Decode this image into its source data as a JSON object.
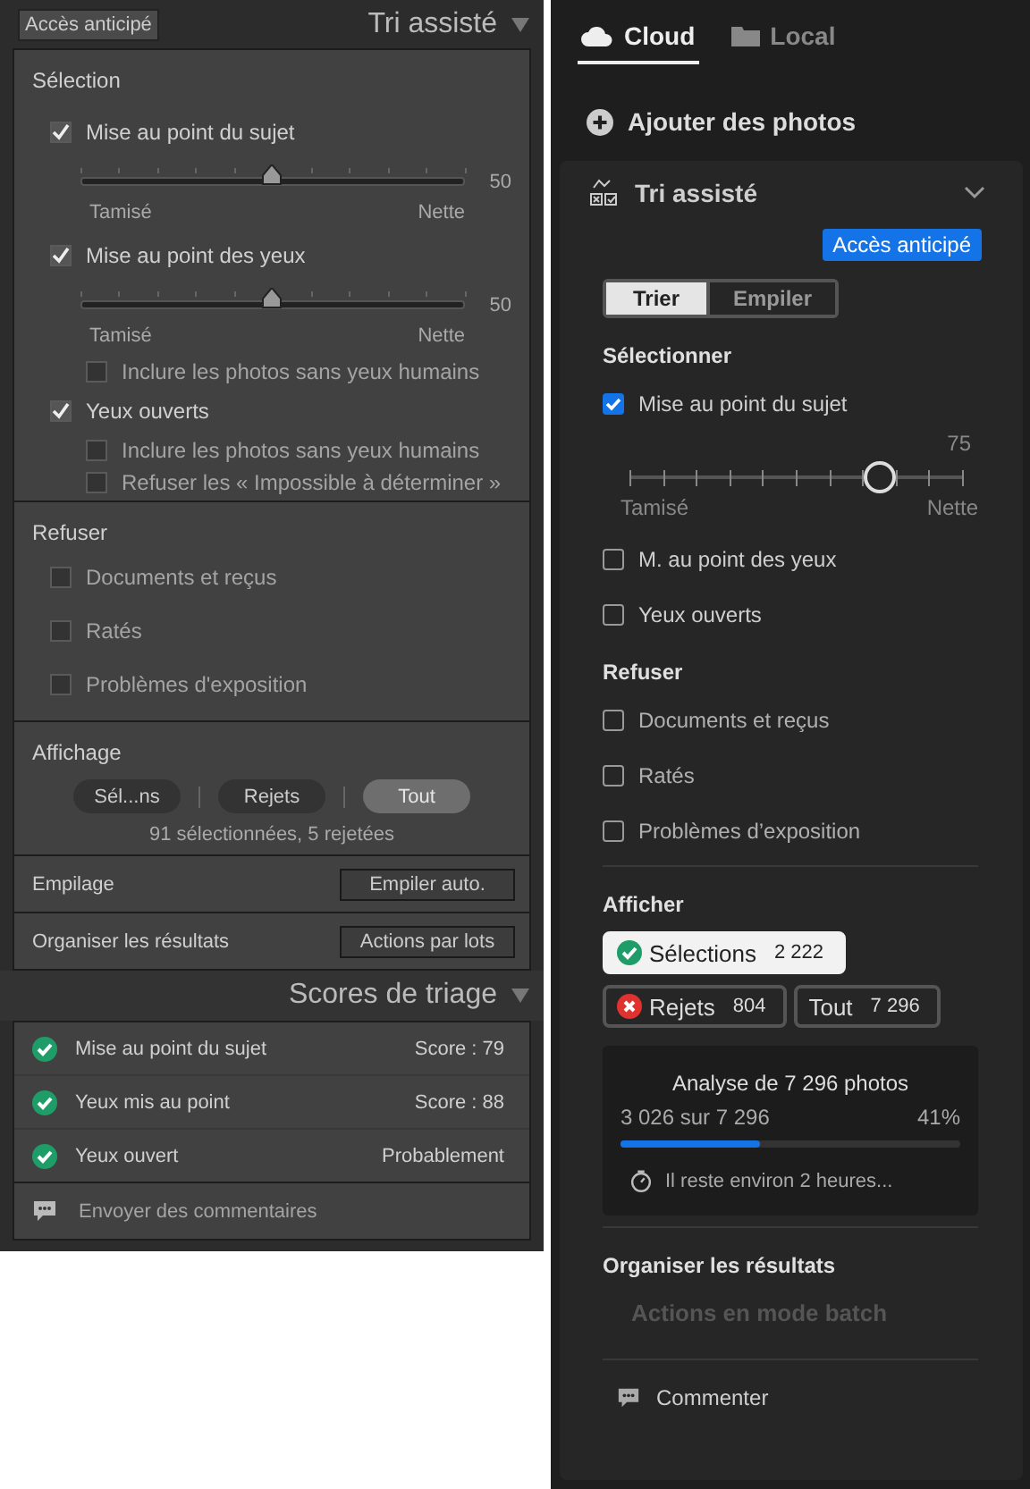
{
  "classic": {
    "early_access": "Accès anticipé",
    "title": "Tri assisté",
    "selection": {
      "heading": "Sélection",
      "criteria": [
        {
          "label": "Mise au point du sujet",
          "checked": true,
          "slider": {
            "level": 0.5,
            "reading": "50",
            "min_label": "Tamisé",
            "max_label": "Nette"
          }
        },
        {
          "label": "Mise au point des yeux",
          "checked": true,
          "slider": {
            "level": 0.5,
            "reading": "50",
            "min_label": "Tamisé",
            "max_label": "Nette"
          },
          "options": [
            {
              "label": "Inclure les photos sans yeux humains",
              "checked": false
            }
          ]
        },
        {
          "label": "Yeux ouverts",
          "checked": true,
          "options": [
            {
              "label": "Inclure les photos sans yeux humains",
              "checked": false
            },
            {
              "label": "Refuser les « Impossible à déterminer »",
              "checked": false
            }
          ]
        }
      ]
    },
    "reject": {
      "heading": "Refuser",
      "items": [
        {
          "label": "Documents et reçus",
          "checked": false
        },
        {
          "label": "Ratés",
          "checked": false
        },
        {
          "label": "Problèmes d'exposition",
          "checked": false
        }
      ]
    },
    "display": {
      "heading": "Affichage",
      "filters": [
        {
          "label": "Sél...ns",
          "selected": false
        },
        {
          "label": "Rejets",
          "selected": false
        },
        {
          "label": "Tout",
          "selected": true
        }
      ],
      "summary": "91 sélectionnées, 5 rejetées"
    },
    "stacking": {
      "label": "Empilage",
      "button": "Empiler auto."
    },
    "organize": {
      "label": "Organiser les résultats",
      "button": "Actions par lots"
    },
    "scores": {
      "title": "Scores de triage",
      "rows": [
        {
          "label": "Mise au point du sujet",
          "value": "Score : 79",
          "passed": true
        },
        {
          "label": "Yeux mis au point",
          "value": "Score : 88",
          "passed": true
        },
        {
          "label": "Yeux ouvert",
          "value": "Probablement",
          "passed": true
        }
      ],
      "feedback": "Envoyer des commentaires"
    }
  },
  "modern": {
    "tabs": [
      {
        "kind": "cloud",
        "label": "Cloud",
        "selected": true
      },
      {
        "kind": "folder",
        "label": "Local",
        "selected": false
      }
    ],
    "add_photos": "Ajouter des photos",
    "section": {
      "title": "Tri assisté",
      "expanded": true,
      "badge": "Accès anticipé",
      "modes": [
        {
          "label": "Trier",
          "selected": true
        },
        {
          "label": "Empiler",
          "selected": false
        }
      ],
      "select": {
        "heading": "Sélectionner",
        "items": [
          {
            "label": "Mise au point du sujet",
            "checked": true,
            "slider": {
              "level": 0.75,
              "reading": "75",
              "min_label": "Tamisé",
              "max_label": "Nette"
            }
          },
          {
            "label": "M. au point des yeux",
            "checked": false
          },
          {
            "label": "Yeux ouverts",
            "checked": false
          }
        ]
      },
      "reject": {
        "heading": "Refuser",
        "items": [
          {
            "label": "Documents et reçus",
            "checked": false
          },
          {
            "label": "Ratés",
            "checked": false
          },
          {
            "label": "Problèmes d’exposition",
            "checked": false
          }
        ]
      },
      "display": {
        "heading": "Afficher",
        "filters": [
          {
            "kind": "pass",
            "label": "Sélections",
            "count": "2 222",
            "selected": true
          },
          {
            "kind": "fail",
            "label": "Rejets",
            "count": "804",
            "selected": false
          },
          {
            "kind": "plain",
            "label": "Tout",
            "count": "7 296",
            "selected": false
          }
        ]
      },
      "progress": {
        "title": "Analyse de 7 296 photos",
        "done": "3 026 sur 7 296",
        "percent": "41%",
        "level": 0.41,
        "remaining": "Il reste environ 2 heures..."
      },
      "organize": {
        "heading": "Organiser les résultats",
        "action": "Actions en mode batch",
        "disabled": true
      },
      "comment": "Commenter"
    }
  }
}
